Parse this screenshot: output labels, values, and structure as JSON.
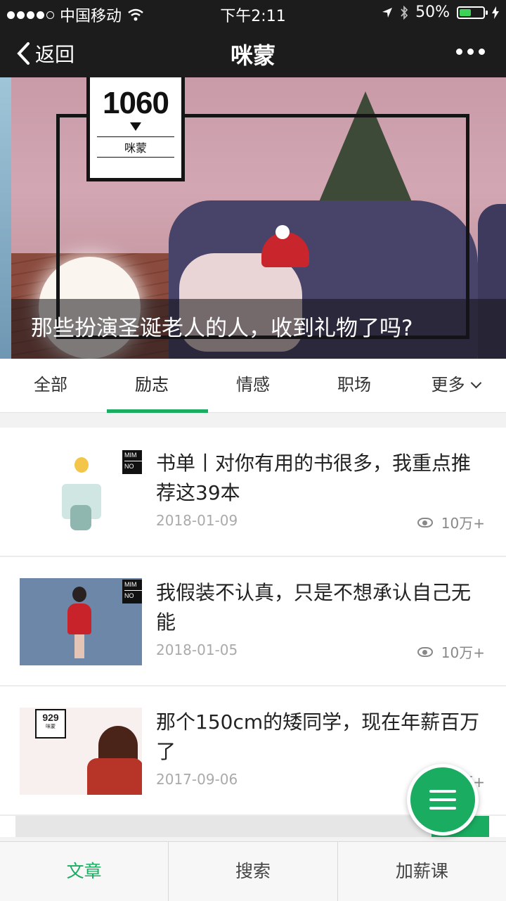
{
  "status": {
    "carrier": "中国移动",
    "time": "下午2:11",
    "battery": "50%",
    "battery_level": 0.5
  },
  "nav": {
    "back_label": "返回",
    "title": "咪蒙"
  },
  "banner": {
    "logo_number": "1060",
    "logo_brand": "咪蒙",
    "caption": "那些扮演圣诞老人的人，收到礼物了吗?"
  },
  "tabs": [
    {
      "label": "全部"
    },
    {
      "label": "励志"
    },
    {
      "label": "情感"
    },
    {
      "label": "职场"
    },
    {
      "label": "更多"
    }
  ],
  "active_tab": "励志",
  "articles": [
    {
      "title": "书单丨对你有用的书很多，我重点推荐这39本",
      "date": "2018-01-09",
      "views": "10万+",
      "tag_lines": [
        "MIM",
        "NO"
      ]
    },
    {
      "title": "我假装不认真，只是不想承认自己无能",
      "date": "2018-01-05",
      "views": "10万+",
      "tag_lines": [
        "MIM",
        "NO"
      ]
    },
    {
      "title": "那个150cm的矮同学，现在年薪百万了",
      "date": "2017-09-06",
      "views": "10万+",
      "logo_number": "929",
      "logo_brand": "咪蒙"
    }
  ],
  "bottom_bar": [
    {
      "label": "文章"
    },
    {
      "label": "搜索"
    },
    {
      "label": "加薪课"
    }
  ],
  "colors": {
    "accent": "#1aad62",
    "bar_background": "#1c1c1c"
  }
}
